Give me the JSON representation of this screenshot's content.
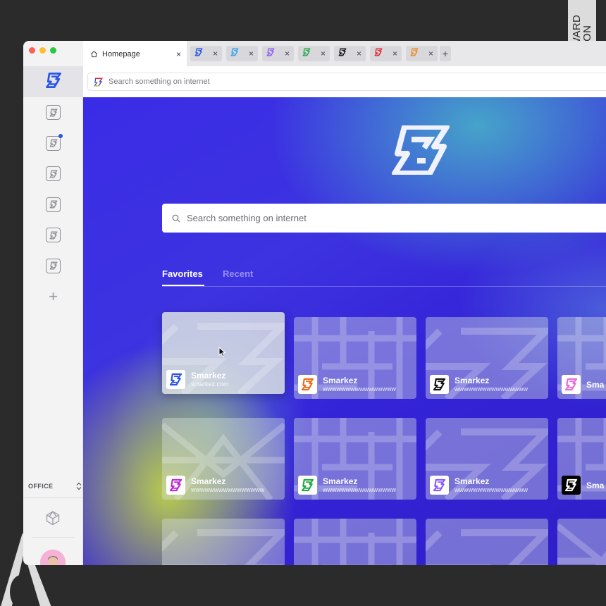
{
  "ribbon": {
    "line1": "A' DESIGN AWARD",
    "line2": "& COMPETITION"
  },
  "window": {
    "traffic_colors": [
      "#ff5f57",
      "#febc2e",
      "#28c840"
    ],
    "accent": "#2855e8"
  },
  "tabbar": {
    "active_tab": {
      "label": "Homepage",
      "icon": "home-icon",
      "close": "×"
    },
    "mini_tabs": [
      {
        "color": "#2855e8",
        "close": "×"
      },
      {
        "color": "#35a2f0",
        "close": "×"
      },
      {
        "color": "#8b5cf6",
        "close": "×"
      },
      {
        "color": "#22a845",
        "close": "×"
      },
      {
        "color": "#111111",
        "close": "×"
      },
      {
        "color": "#e5232e",
        "close": "×"
      },
      {
        "color": "#f08a24",
        "close": "×"
      }
    ],
    "new_tab": "+"
  },
  "urlbar": {
    "placeholder": "Search something on internet"
  },
  "sidebar": {
    "workspace": "OFFICE",
    "workspace_toggle": "⌃⌄",
    "add": "+",
    "items": [
      {
        "name": "app-smarkez",
        "active": true,
        "notif": false
      },
      {
        "name": "app-1",
        "active": false,
        "notif": false
      },
      {
        "name": "app-2",
        "active": false,
        "notif": true
      },
      {
        "name": "app-3",
        "active": false,
        "notif": false
      },
      {
        "name": "app-4",
        "active": false,
        "notif": false
      },
      {
        "name": "app-5",
        "active": false,
        "notif": false
      },
      {
        "name": "app-6",
        "active": false,
        "notif": false
      }
    ]
  },
  "main": {
    "search_placeholder": "Search something on internet",
    "tabs": [
      {
        "label": "Favorites"
      },
      {
        "label": "Recent"
      }
    ],
    "cards": [
      {
        "title": "Smarkez",
        "url": "smarkez.com",
        "color": "#2855e8",
        "pattern": "z"
      },
      {
        "title": "Smarkez",
        "url": "wwwwwwwwwwwwwwww",
        "color": "#f06a1c",
        "pattern": "grid"
      },
      {
        "title": "Smarkez",
        "url": "wwwwwwwwwwwwwwww",
        "color": "#111111",
        "pattern": "z"
      },
      {
        "title": "Sma",
        "url": "",
        "color": "#e86bd8",
        "pattern": "grid"
      },
      {
        "title": "Smarkez",
        "url": "wwwwwwwwwwwwwwww",
        "color": "#c026d3",
        "pattern": "tri"
      },
      {
        "title": "Smarkez",
        "url": "wwwwwwwwwwwwwwww",
        "color": "#22a845",
        "pattern": "grid"
      },
      {
        "title": "Smarkez",
        "url": "wwwwwwwwwwwwwwww",
        "color": "#8b5cf6",
        "pattern": "z"
      },
      {
        "title": "Sma",
        "url": "",
        "color": "#111111",
        "pattern": "grid",
        "dark": true
      },
      {
        "title": "",
        "url": "",
        "color": "",
        "pattern": "z"
      },
      {
        "title": "",
        "url": "",
        "color": "",
        "pattern": "grid"
      },
      {
        "title": "",
        "url": "",
        "color": "",
        "pattern": "z"
      },
      {
        "title": "",
        "url": "",
        "color": "",
        "pattern": "tri"
      }
    ]
  }
}
